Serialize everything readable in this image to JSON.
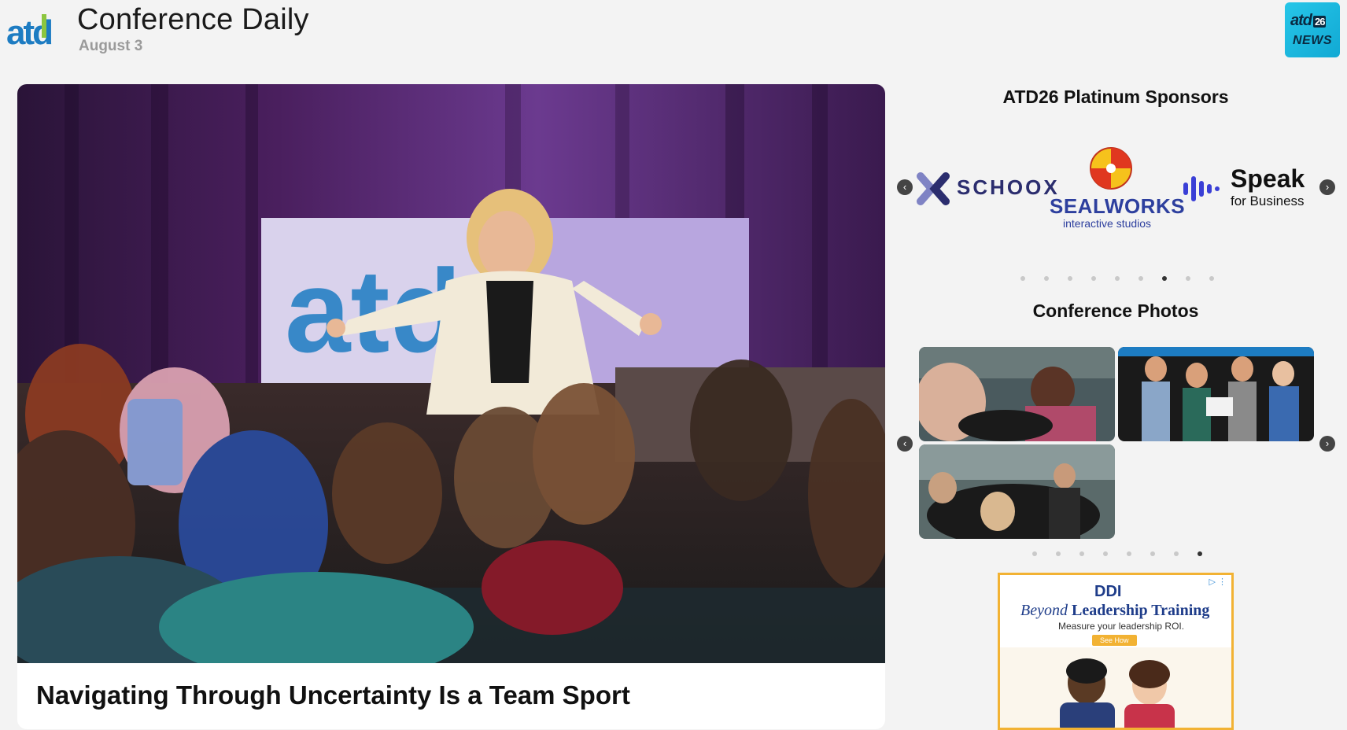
{
  "header": {
    "logo_text": "atd",
    "title": "Conference Daily",
    "date": "August 3",
    "badge": {
      "line1": "atd",
      "year": "26",
      "line2": "NEWS"
    }
  },
  "main": {
    "hero_stage_sign": "atd",
    "article_title": "Navigating Through Uncertainty Is a Team Sport"
  },
  "sponsors": {
    "title": "ATD26 Platinum Sponsors",
    "items": [
      {
        "name": "SCHOOX"
      },
      {
        "name": "SEALWORKS",
        "tagline": "interactive studios"
      },
      {
        "name": "Speak",
        "tagline": "for Business"
      }
    ],
    "dots": 9,
    "active_dot": 7
  },
  "photos": {
    "title": "Conference Photos",
    "dots": 8,
    "active_dot": 8
  },
  "ad": {
    "brand": "DDI",
    "headline_italic": "Beyond",
    "headline_rest": " Leadership Training",
    "subline": "Measure your leadership ROI.",
    "cta": "See How",
    "adchoices": "▷ ⋮"
  },
  "icons": {
    "prev": "‹",
    "next": "›"
  },
  "colors": {
    "atd_blue": "#1d7cc2",
    "atd_green": "#8cc63f",
    "badge": "#1fb8df",
    "ad_border": "#f2b233"
  }
}
